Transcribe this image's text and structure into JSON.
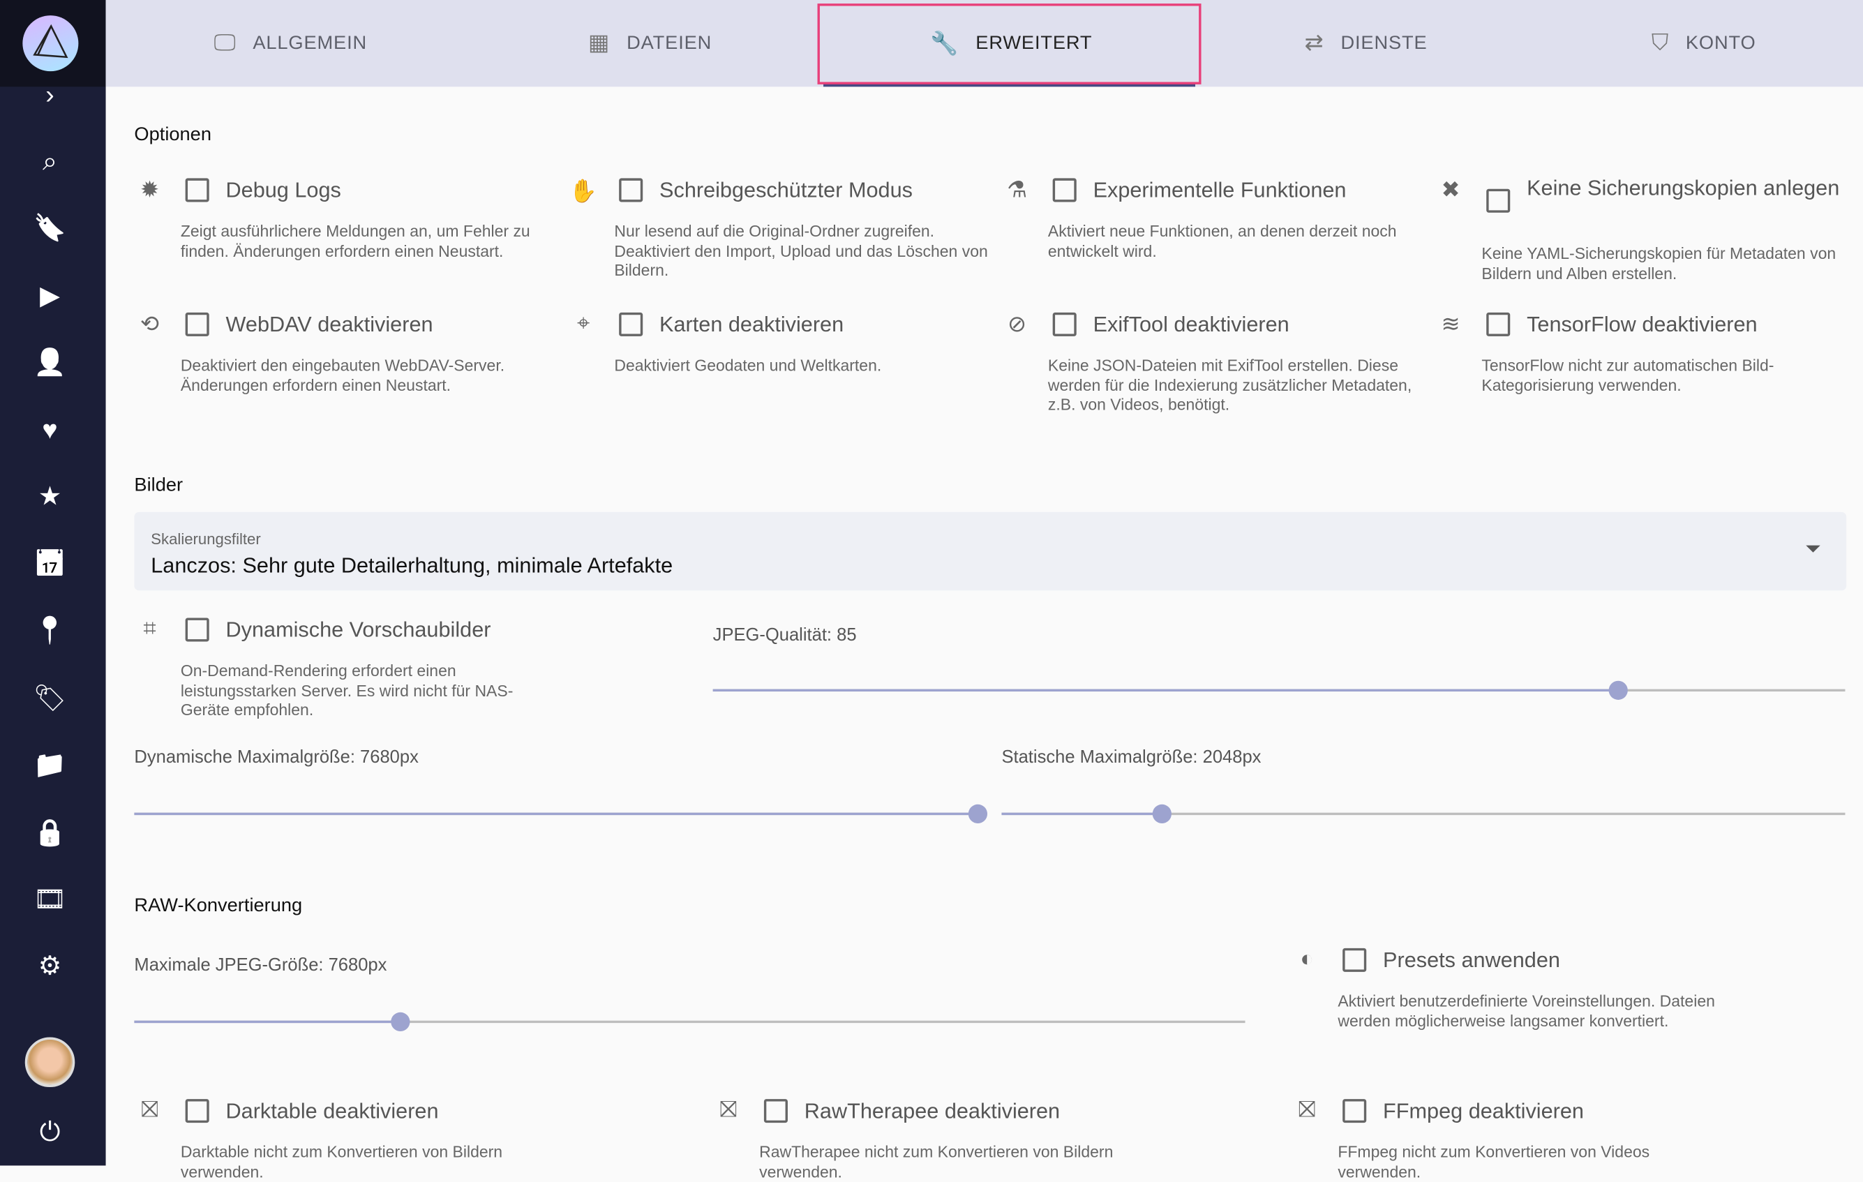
{
  "colors": {
    "accent": "#e8407a",
    "sidebar": "#1b1e37",
    "tab_bar": "#dfe0ee",
    "slider": "#9da3cf"
  },
  "sidebar": {
    "items": [
      {
        "name": "expand",
        "icon": "chevron-right-icon",
        "glyph": "›"
      },
      {
        "name": "search",
        "icon": "search-icon",
        "glyph": "⌕"
      },
      {
        "name": "bookmark",
        "icon": "bookmark-icon",
        "glyph": "🔖"
      },
      {
        "name": "play",
        "icon": "play-icon",
        "glyph": "▶"
      },
      {
        "name": "people",
        "icon": "person-icon",
        "glyph": "👤"
      },
      {
        "name": "favorites",
        "icon": "heart-icon",
        "glyph": "♥"
      },
      {
        "name": "starred",
        "icon": "star-icon",
        "glyph": "★"
      },
      {
        "name": "calendar",
        "icon": "calendar-icon",
        "glyph": "📅"
      },
      {
        "name": "places",
        "icon": "location-pin-icon",
        "glyph": "📍"
      },
      {
        "name": "labels",
        "icon": "label-icon",
        "glyph": "🏷"
      },
      {
        "name": "folders",
        "icon": "folder-icon",
        "glyph": "📁"
      },
      {
        "name": "private",
        "icon": "lock-icon",
        "glyph": "🔒"
      },
      {
        "name": "library",
        "icon": "film-icon",
        "glyph": "🎞"
      },
      {
        "name": "settings",
        "icon": "gear-icon",
        "glyph": "⚙"
      },
      {
        "name": "avatar",
        "icon": "avatar-icon",
        "glyph": ""
      },
      {
        "name": "logout",
        "icon": "power-icon",
        "glyph": "⏻"
      }
    ]
  },
  "tabs": [
    {
      "label": "ALLGEMEIN",
      "icon": "monitor-icon",
      "glyph": "🖵"
    },
    {
      "label": "DATEIEN",
      "icon": "film-icon",
      "glyph": "▦"
    },
    {
      "label": "ERWEITERT",
      "icon": "wrench-icon",
      "glyph": "🔧",
      "active": true
    },
    {
      "label": "DIENSTE",
      "icon": "swap-icon",
      "glyph": "⇄"
    },
    {
      "label": "KONTO",
      "icon": "shield-account-icon",
      "glyph": "⛉"
    }
  ],
  "options": {
    "title": "Optionen",
    "items": [
      {
        "icon": "bug-icon",
        "glyph": "✹",
        "label": "Debug Logs",
        "desc": "Zeigt ausführlichere Meldungen an, um Fehler zu finden. Änderungen erfordern einen Neustart.",
        "checked": false
      },
      {
        "icon": "hand-icon",
        "glyph": "✋",
        "label": "Schreibgeschützter Modus",
        "desc": "Nur lesend auf die Original-Ordner zugreifen. Deaktiviert den Import, Upload und das Löschen von Bildern.",
        "checked": false
      },
      {
        "icon": "flask-icon",
        "glyph": "⚗",
        "label": "Experimentelle Funktionen",
        "desc": "Aktiviert neue Funktionen, an denen derzeit noch entwickelt wird.",
        "checked": false
      },
      {
        "icon": "bandage-off-icon",
        "glyph": "✖",
        "label": "Keine Sicherungskopien anlegen",
        "desc": "Keine YAML-Sicherungskopien für Metadaten von Bildern und Alben erstellen.",
        "checked": false
      },
      {
        "icon": "sync-off-icon",
        "glyph": "⟲",
        "label": "WebDAV deaktivieren",
        "desc": "Deaktiviert den eingebauten WebDAV-Server. Änderungen erfordern einen Neustart.",
        "checked": false
      },
      {
        "icon": "map-marker-off-icon",
        "glyph": "⌖",
        "label": "Karten deaktivieren",
        "desc": "Deaktiviert Geodaten und Weltkarten.",
        "checked": false
      },
      {
        "icon": "camera-off-icon",
        "glyph": "⊘",
        "label": "ExifTool deaktivieren",
        "desc": "Keine JSON-Dateien mit ExifTool erstellen. Diese werden für die Indexierung zusätzlicher Metadaten, z.B. von Videos, benötigt.",
        "checked": false
      },
      {
        "icon": "layers-off-icon",
        "glyph": "≋",
        "label": "TensorFlow deaktivieren",
        "desc": "TensorFlow nicht zur automatischen Bild-Kategorisierung verwenden.",
        "checked": false
      }
    ]
  },
  "images": {
    "title": "Bilder",
    "select": {
      "label": "Skalierungsfilter",
      "value": "Lanczos: Sehr gute Detailerhaltung, minimale Artefakte"
    },
    "dynamic_previews": {
      "icon": "chip-icon",
      "glyph": "⌗",
      "label": "Dynamische Vorschaubilder",
      "desc": "On-Demand-Rendering erfordert einen leistungsstarken Server. Es wird nicht für NAS-Geräte empfohlen.",
      "checked": false
    },
    "jpeg_quality": {
      "label": "JPEG-Qualität: 85",
      "value": 85,
      "fraction": 0.8
    },
    "dynamic_max": {
      "label": "Dynamische Maximalgröße: 7680px",
      "value": 7680,
      "fraction": 0.99
    },
    "static_max": {
      "label": "Statische Maximalgröße: 2048px",
      "value": 2048,
      "fraction": 0.19
    }
  },
  "raw": {
    "title": "RAW-Konvertierung",
    "jpeg_max": {
      "label": "Maximale JPEG-Größe: 7680px",
      "value": 7680,
      "fraction": 0.24
    },
    "presets": {
      "icon": "contrast-icon",
      "glyph": "◐",
      "label": "Presets anwenden",
      "desc": "Aktiviert benutzerdefinierte Voreinstellungen. Dateien werden möglicherweise langsamer konvertiert.",
      "checked": false
    },
    "darktable": {
      "icon": "image-off-icon",
      "glyph": "⛝",
      "label": "Darktable deaktivieren",
      "desc": "Darktable nicht zum Konvertieren von Bildern verwenden.",
      "checked": false
    },
    "rawtherapee": {
      "icon": "image-off-icon",
      "glyph": "⛝",
      "label": "RawTherapee deaktivieren",
      "desc": "RawTherapee nicht zum Konvertieren von Bildern verwenden.",
      "checked": false
    },
    "ffmpeg": {
      "icon": "video-off-icon",
      "glyph": "⛝",
      "label": "FFmpeg deaktivieren",
      "desc": "FFmpeg nicht zum Konvertieren von Videos verwenden.",
      "checked": false
    }
  }
}
